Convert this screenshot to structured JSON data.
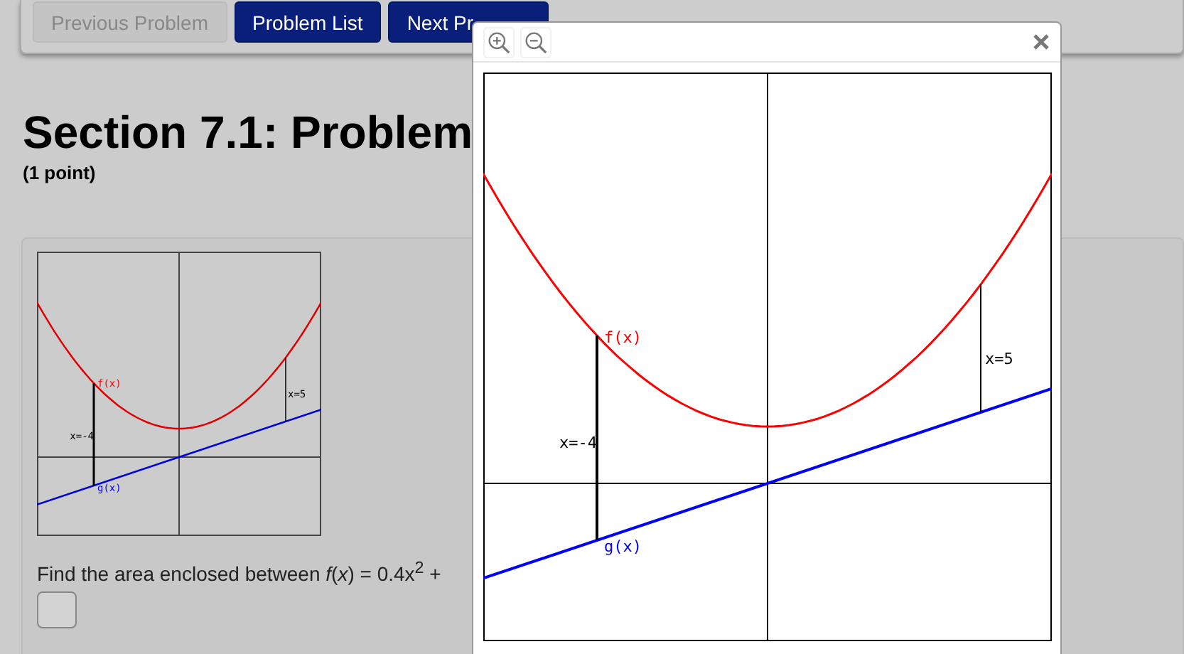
{
  "nav": {
    "buttons": [
      {
        "label": "Previous Problem",
        "disabled": true
      },
      {
        "label": "Problem List",
        "disabled": false
      },
      {
        "label": "Next Pr",
        "disabled": false
      }
    ]
  },
  "heading": "Section 7.1: Problem",
  "points": "(1 point)",
  "problem": {
    "graph_labels": [
      {
        "text": "f(x)",
        "color": "#ff0000"
      },
      {
        "text": "x=-4",
        "color": "#000000"
      },
      {
        "text": "x=5",
        "color": "#000000"
      },
      {
        "text": "g(x)",
        "color": "#0000ff"
      }
    ],
    "question": "Find the area enclosed between *f*(*x*) = 0.4x$^{2}$ +"
  },
  "modal": {
    "graph_labels": [
      {
        "text": "f(x)",
        "color": "#ff0000"
      },
      {
        "text": "x=-4",
        "color": "#000000"
      },
      {
        "text": "x=5",
        "color": "#000000"
      },
      {
        "text": "g(x)",
        "color": "#0000ff"
      }
    ]
  }
}
